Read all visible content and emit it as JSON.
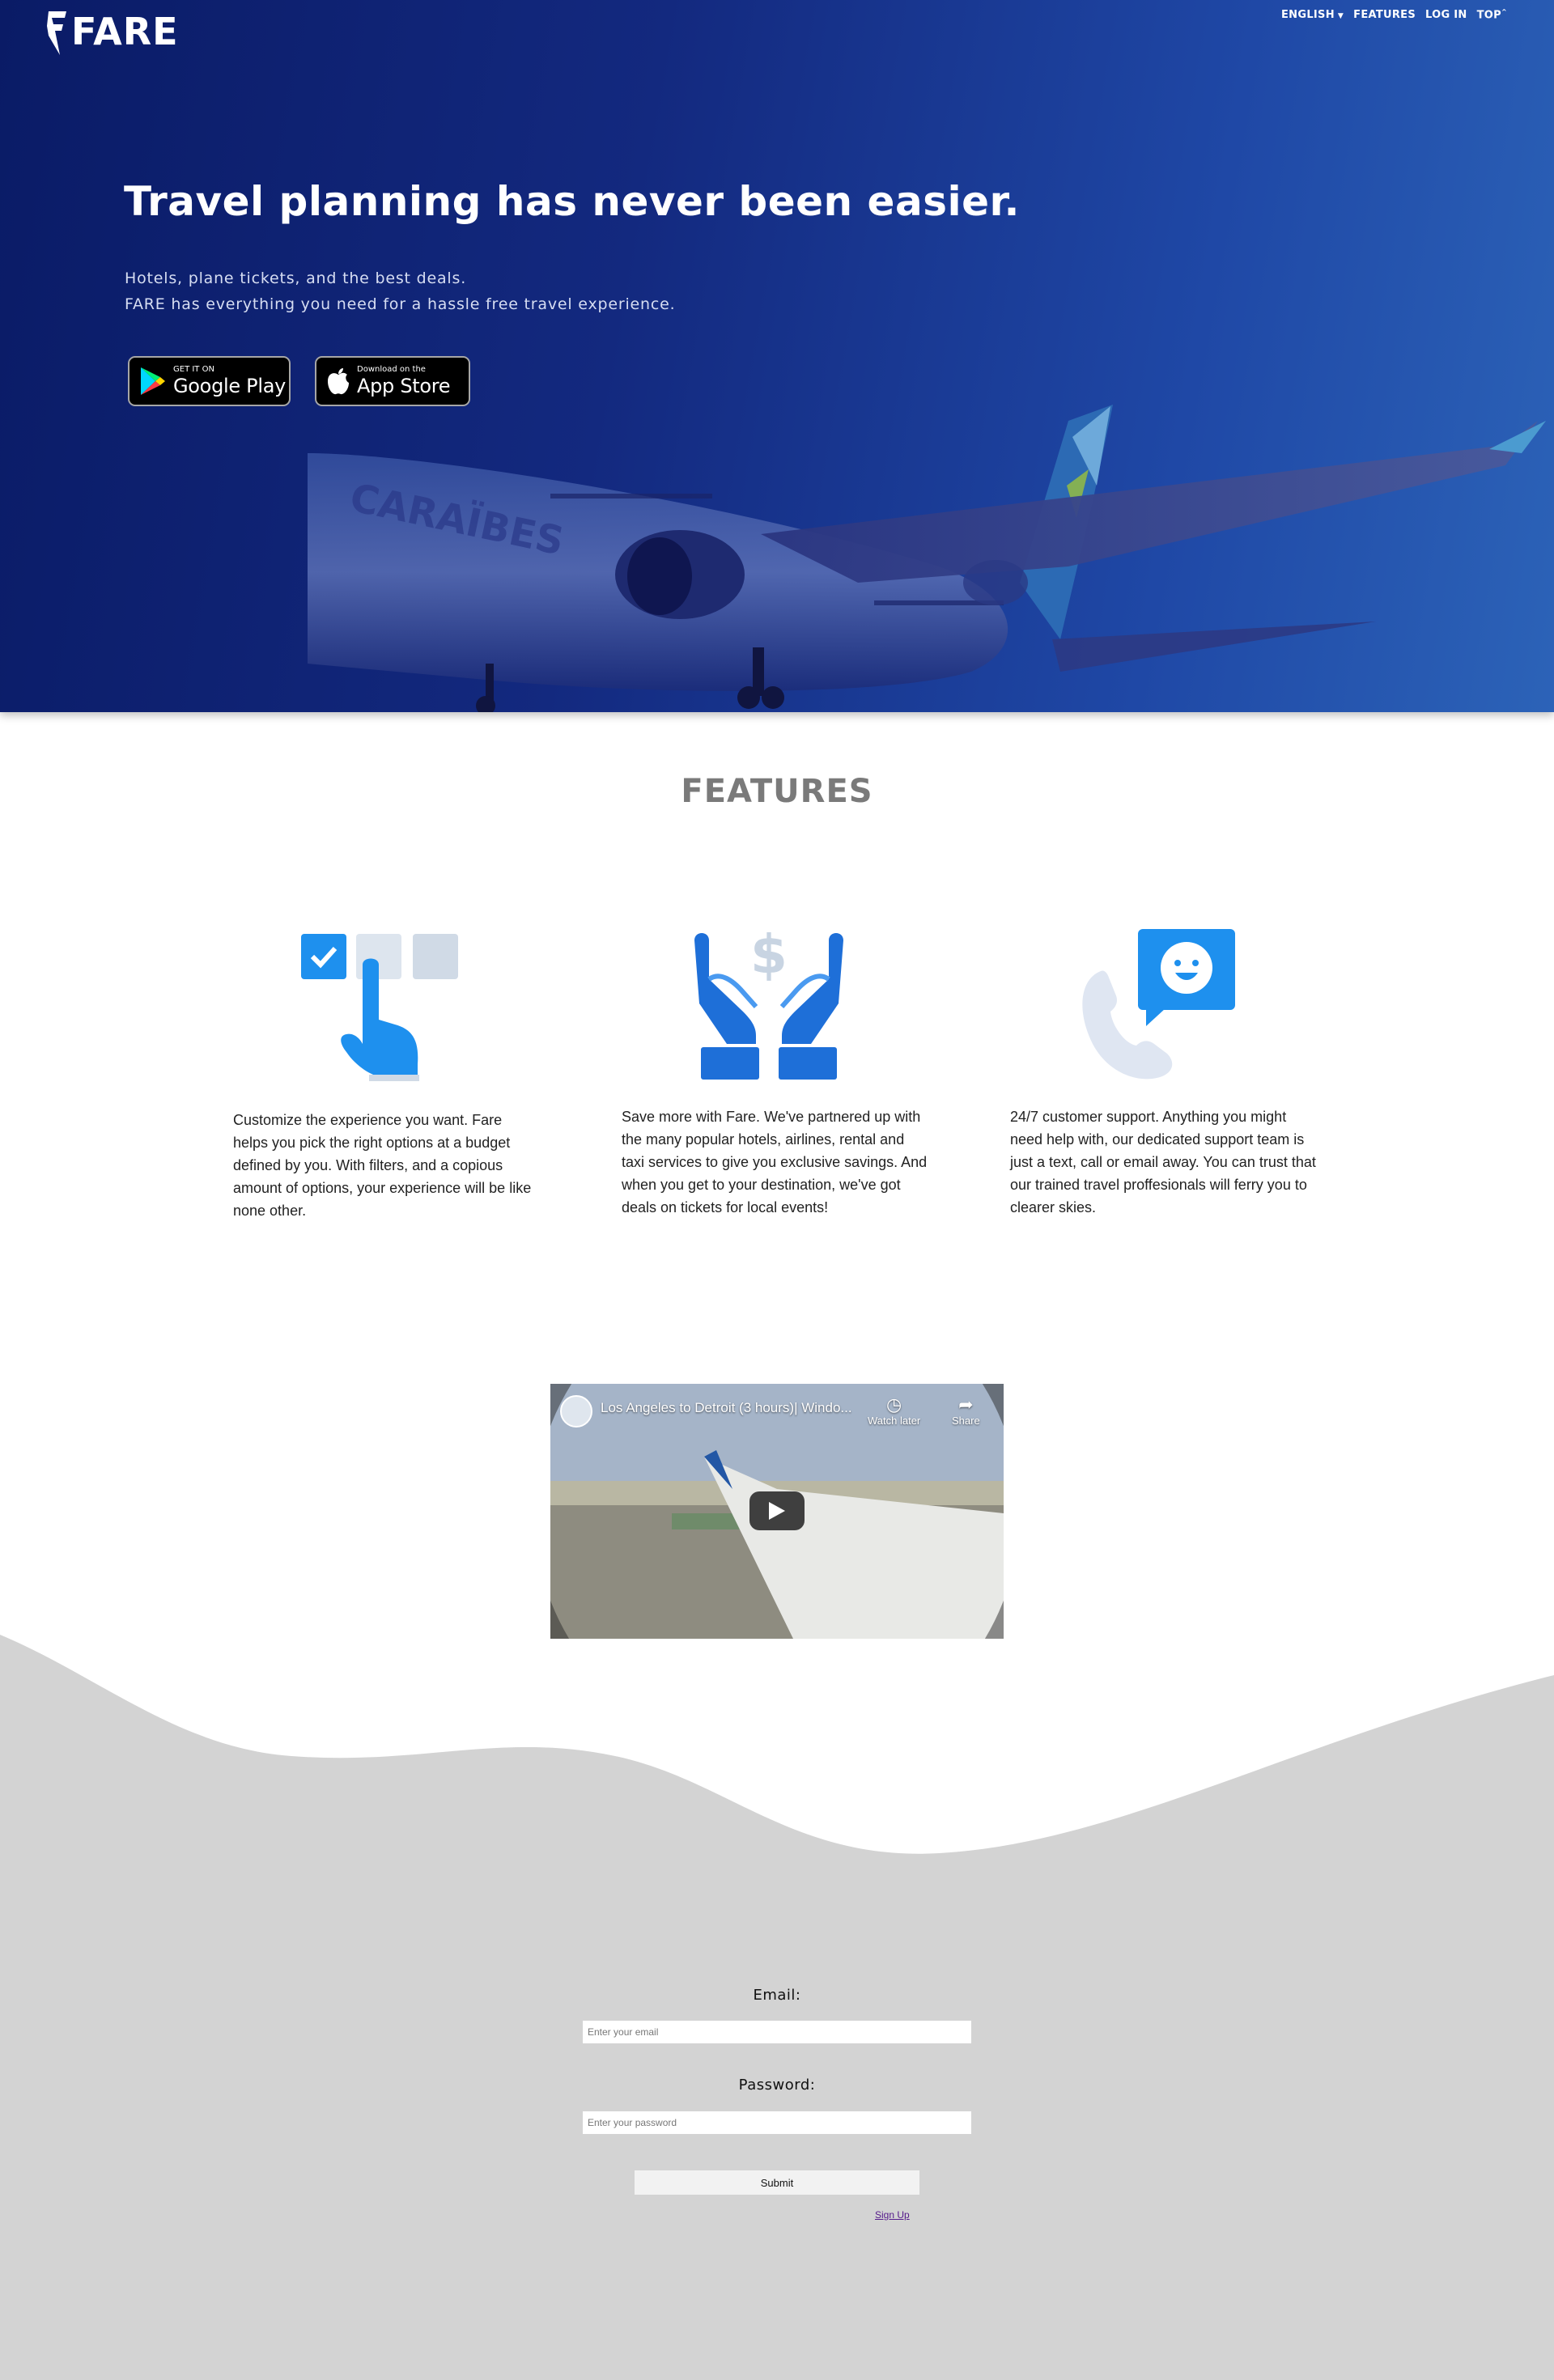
{
  "brand": {
    "name": "FARE"
  },
  "nav": {
    "items": [
      "ENGLISH",
      "FEATURES",
      "LOG IN",
      "TOP"
    ],
    "top_sup": "^"
  },
  "hero": {
    "title": "Travel planning has never been easier.",
    "subtitle_line1": "Hotels, plane tickets, and the best deals.",
    "subtitle_line2": "FARE has everything you need for a hassle free travel experience.",
    "plane_livery": "CARAÏBES",
    "google_play": {
      "small": "GET IT ON",
      "big": "Google Play"
    },
    "app_store": {
      "small": "Download on the",
      "big": "App Store"
    }
  },
  "features": {
    "title": "FEATURES",
    "items": [
      {
        "icon": "pointer-select-icon",
        "text": "Customize the experience you want. Fare helps you pick the right options at a budget defined by you. With filters, and a copious amount of options, your experience will be like none other."
      },
      {
        "icon": "hands-dollar-icon",
        "text": "Save more with Fare. We've partnered up with the many popular hotels, airlines, rental and taxi services to give you exclusive savings. And when you get to your destination, we've got deals on tickets for local events!"
      },
      {
        "icon": "phone-chat-icon",
        "text": "24/7 customer support. Anything you might need help with, our dedicated support team is just a text, call or email away. You can trust that our trained travel proffesionals will ferry you to clearer skies."
      }
    ]
  },
  "video": {
    "title": "Los Angeles to Detroit (3 hours)| Windo...",
    "watch_later": "Watch later",
    "share": "Share"
  },
  "login": {
    "email_label": "Email:",
    "email_placeholder": "Enter your email",
    "password_label": "Password:",
    "password_placeholder": "Enter your password",
    "submit": "Submit",
    "signup": "Sign Up"
  },
  "colors": {
    "hero_dark": "#0a1b66",
    "hero_light": "#2c63b8",
    "accent_blue": "#1e90ee",
    "icon_grey": "#d0dae6",
    "grey_bg": "#d3d3d3"
  }
}
